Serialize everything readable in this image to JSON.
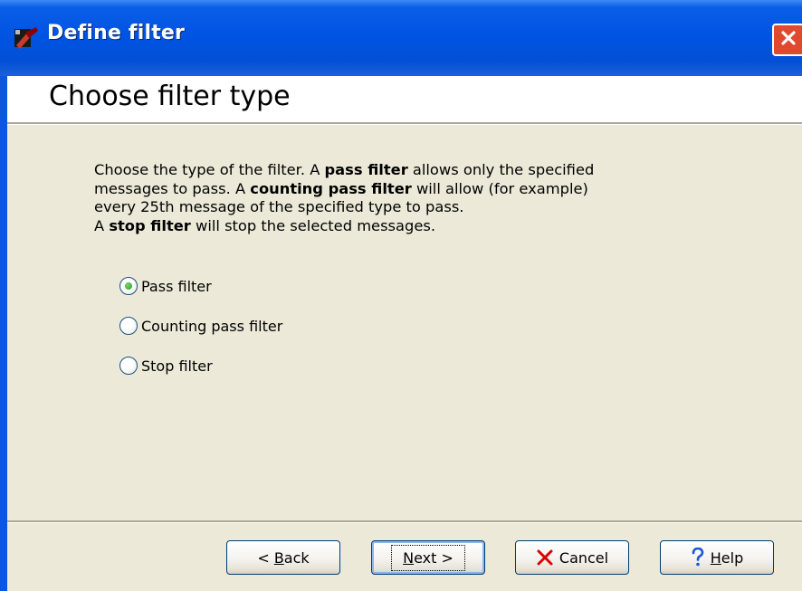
{
  "window": {
    "title": "Define filter",
    "app_icon": "filter-app-icon",
    "close_icon": "close-icon"
  },
  "header": {
    "title": "Choose filter type"
  },
  "description": {
    "line1_pre": "Choose the type of the filter. A ",
    "line1_bold": "pass filter",
    "line1_post": " allows only the specified",
    "line2_pre": "messages to pass. A ",
    "line2_bold": "counting pass filter",
    "line2_post": " will allow (for example)",
    "line3": "every 25th message of the specified type to pass.",
    "line4_pre": "A ",
    "line4_bold": "stop filter",
    "line4_post": " will stop the selected messages."
  },
  "options": [
    {
      "label": "Pass filter",
      "selected": true
    },
    {
      "label": "Counting pass filter",
      "selected": false
    },
    {
      "label": "Stop filter",
      "selected": false
    }
  ],
  "buttons": {
    "back": {
      "prefix": "< ",
      "mnemonic": "B",
      "rest": "ack"
    },
    "next": {
      "mnemonic": "N",
      "rest": "ext >"
    },
    "cancel": {
      "label": "Cancel",
      "icon": "x-icon"
    },
    "help": {
      "mnemonic": "H",
      "rest": "elp",
      "icon": "question-icon"
    }
  },
  "colors": {
    "title_bar": "#0054e3",
    "close_button": "#e0492d",
    "cancel_x": "#e00000",
    "help_q": "#1a55d8"
  }
}
